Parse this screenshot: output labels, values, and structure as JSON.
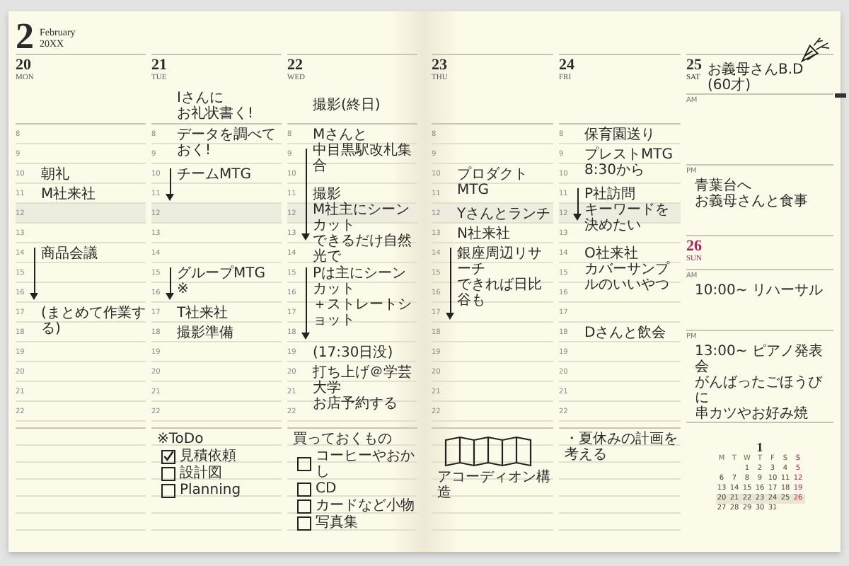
{
  "pages": [
    {
      "month": {
        "number": "2",
        "name": "February",
        "year": "20XX"
      },
      "days": [
        {
          "date": "20",
          "weekday": "MON",
          "slots": [
            {
              "hour": "8",
              "arrow": false
            },
            {
              "hour": "9",
              "arrow": false
            },
            {
              "hour": "10",
              "arrow": false,
              "lines": [
                "朝礼"
              ]
            },
            {
              "hour": "11",
              "arrow": false,
              "lines": [
                "M社来社"
              ]
            },
            {
              "hour": "12",
              "arrow": false
            },
            {
              "hour": "13",
              "arrow": false
            },
            {
              "hour": "14",
              "arrow": true,
              "lines": [
                "商品会議"
              ]
            },
            {
              "hour": "15",
              "arrow": true
            },
            {
              "hour": "16",
              "arrow": true
            },
            {
              "hour": "17",
              "arrow": false,
              "lines": [
                "(まとめて作業する)"
              ]
            },
            {
              "hour": "18",
              "arrow": false
            },
            {
              "hour": "19",
              "arrow": false
            },
            {
              "hour": "20",
              "arrow": false
            },
            {
              "hour": "21",
              "arrow": false
            },
            {
              "hour": "22",
              "arrow": false
            }
          ]
        },
        {
          "date": "21",
          "weekday": "TUE",
          "top_note": [
            "Iさんに",
            "お礼状書く!"
          ],
          "slots": [
            {
              "hour": "8",
              "arrow": false,
              "lines": [
                "データを調べておく!"
              ]
            },
            {
              "hour": "9",
              "arrow": false
            },
            {
              "hour": "10",
              "arrow": true,
              "lines": [
                "チームMTG"
              ]
            },
            {
              "hour": "11",
              "arrow": true
            },
            {
              "hour": "12",
              "arrow": false
            },
            {
              "hour": "13",
              "arrow": false
            },
            {
              "hour": "14",
              "arrow": false
            },
            {
              "hour": "15",
              "arrow": true,
              "lines": [
                "グループMTG",
                "※"
              ]
            },
            {
              "hour": "16",
              "arrow": true
            },
            {
              "hour": "17",
              "arrow": false,
              "lines": [
                "T社来社"
              ]
            },
            {
              "hour": "18",
              "arrow": false,
              "lines": [
                "撮影準備"
              ]
            },
            {
              "hour": "19",
              "arrow": false
            },
            {
              "hour": "20",
              "arrow": false
            },
            {
              "hour": "21",
              "arrow": false
            },
            {
              "hour": "22",
              "arrow": false
            }
          ],
          "memo": [
            {
              "kind": "heading",
              "text": "※ToDo"
            },
            {
              "kind": "check",
              "text": "見積依頼",
              "checked": true
            },
            {
              "kind": "check",
              "text": "設計図",
              "checked": false
            },
            {
              "kind": "check",
              "text": "Planning",
              "checked": false
            }
          ]
        },
        {
          "date": "22",
          "weekday": "WED",
          "top_note": [
            "撮影(終日)"
          ],
          "slots": [
            {
              "hour": "8",
              "arrow": false,
              "lines": [
                "Mさんと",
                "中目黒駅改札集合"
              ]
            },
            {
              "hour": "9",
              "arrow": true
            },
            {
              "hour": "10",
              "arrow": true
            },
            {
              "hour": "11",
              "arrow": true,
              "lines": [
                "撮影",
                "M社主にシーンカット",
                "できるだけ自然光で"
              ]
            },
            {
              "hour": "12",
              "arrow": true
            },
            {
              "hour": "13",
              "arrow": true
            },
            {
              "hour": "14",
              "arrow": false
            },
            {
              "hour": "15",
              "arrow": true,
              "lines": [
                "Pは主にシーンカット",
                "＋ストレートショット"
              ]
            },
            {
              "hour": "16",
              "arrow": true
            },
            {
              "hour": "17",
              "arrow": true
            },
            {
              "hour": "18",
              "arrow": true
            },
            {
              "hour": "19",
              "arrow": false,
              "lines": [
                "(17:30日没)"
              ]
            },
            {
              "hour": "20",
              "arrow": false,
              "lines": [
                "打ち上げ＠学芸大学",
                "お店予約する"
              ]
            },
            {
              "hour": "21",
              "arrow": false
            },
            {
              "hour": "22",
              "arrow": false
            }
          ],
          "memo": [
            {
              "kind": "heading",
              "text": "買っておくもの"
            },
            {
              "kind": "check",
              "text": "コーヒーやおかし",
              "checked": false
            },
            {
              "kind": "check",
              "text": "CD",
              "checked": false
            },
            {
              "kind": "check",
              "text": "カードなど小物",
              "checked": false
            },
            {
              "kind": "check",
              "text": "写真集",
              "checked": false
            }
          ]
        }
      ]
    },
    {
      "days": [
        {
          "date": "23",
          "weekday": "THU",
          "slots": [
            {
              "hour": "8",
              "arrow": false
            },
            {
              "hour": "9",
              "arrow": false
            },
            {
              "hour": "10",
              "arrow": false,
              "lines": [
                "プロダクトMTG"
              ]
            },
            {
              "hour": "11",
              "arrow": false
            },
            {
              "hour": "12",
              "arrow": false,
              "lines": [
                "Yさんとランチ"
              ]
            },
            {
              "hour": "13",
              "arrow": false,
              "lines": [
                "N社来社"
              ]
            },
            {
              "hour": "14",
              "arrow": true,
              "lines": [
                "銀座周辺リサーチ",
                "できれば日比谷も"
              ]
            },
            {
              "hour": "15",
              "arrow": true
            },
            {
              "hour": "16",
              "arrow": true
            },
            {
              "hour": "17",
              "arrow": true
            },
            {
              "hour": "18",
              "arrow": false
            },
            {
              "hour": "19",
              "arrow": false
            },
            {
              "hour": "20",
              "arrow": false
            },
            {
              "hour": "21",
              "arrow": false
            },
            {
              "hour": "22",
              "arrow": false
            }
          ],
          "memo": [
            {
              "kind": "sketch"
            },
            {
              "kind": "text",
              "text": "アコーディオン構造"
            }
          ]
        },
        {
          "date": "24",
          "weekday": "FRI",
          "slots": [
            {
              "hour": "8",
              "arrow": false,
              "lines": [
                "保育園送り"
              ]
            },
            {
              "hour": "9",
              "arrow": false,
              "lines": [
                "プレストMTG 8:30から"
              ]
            },
            {
              "hour": "10",
              "arrow": false
            },
            {
              "hour": "11",
              "arrow": true,
              "lines": [
                "P社訪問",
                "キーワードを決めたい"
              ]
            },
            {
              "hour": "12",
              "arrow": true
            },
            {
              "hour": "13",
              "arrow": false
            },
            {
              "hour": "14",
              "arrow": false,
              "lines": [
                "O社来社",
                "カバーサンプルのいいやつ"
              ]
            },
            {
              "hour": "15",
              "arrow": false
            },
            {
              "hour": "16",
              "arrow": false
            },
            {
              "hour": "17",
              "arrow": false
            },
            {
              "hour": "18",
              "arrow": false,
              "lines": [
                "Dさんと飲会"
              ]
            },
            {
              "hour": "19",
              "arrow": false
            },
            {
              "hour": "20",
              "arrow": false
            },
            {
              "hour": "21",
              "arrow": false
            },
            {
              "hour": "22",
              "arrow": false
            }
          ],
          "memo": [
            {
              "kind": "text",
              "text": "・夏休みの計画を考える"
            }
          ]
        }
      ],
      "weekend": [
        {
          "date": "25",
          "weekday": "SAT",
          "color": "#333333",
          "top_note": [
            "お義母さんB.D",
            "(60才)"
          ],
          "am": {
            "label": "AM"
          },
          "pm": {
            "label": "PM",
            "lines": [
              "青葉台へ",
              "お義母さんと食事"
            ]
          }
        },
        {
          "date": "26",
          "weekday": "SUN",
          "color": "#b0205a",
          "am": {
            "label": "AM",
            "lines": [
              "10:00~ リハーサル"
            ]
          },
          "pm": {
            "label": "PM",
            "lines": [
              "13:00~ ピアノ発表会",
              "がんばったごほうびに",
              "串カツやお好み焼"
            ]
          }
        }
      ],
      "mini_calendar": {
        "month": "1",
        "weekdays": [
          "M",
          "T",
          "W",
          "T",
          "F",
          "S",
          "S"
        ],
        "weeks": [
          {
            "days": [
              "1",
              "2",
              "3",
              "4",
              "5"
            ],
            "selected": false
          },
          {
            "days": [
              "6",
              "7",
              "8",
              "9",
              "10",
              "11",
              "12"
            ],
            "selected": false
          },
          {
            "days": [
              "13",
              "14",
              "15",
              "16",
              "17",
              "18",
              "19"
            ],
            "selected": false
          },
          {
            "days": [
              "20",
              "21",
              "22",
              "23",
              "24",
              "25",
              "26"
            ],
            "selected": true
          },
          {
            "days": [
              "27",
              "28",
              "29",
              "30",
              "31"
            ],
            "selected": false
          }
        ]
      }
    }
  ]
}
